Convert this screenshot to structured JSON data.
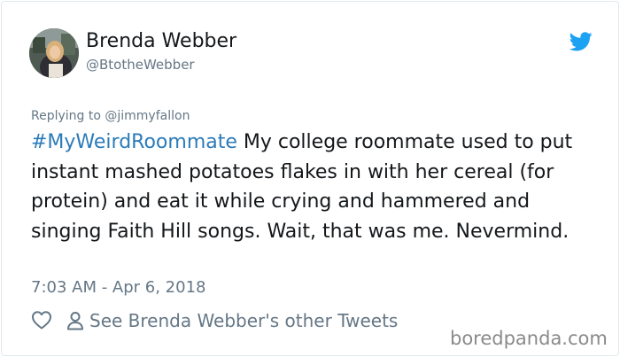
{
  "tweet": {
    "author_name": "Brenda Webber",
    "author_handle": "@BtotheWebber",
    "replying_to": "Replying to @jimmyfallon",
    "hashtag": "#MyWeirdRoommate",
    "body": " My college roommate used to put instant mashed potatoes flakes in with her cereal (for protein) and eat it while crying and hammered and singing Faith Hill songs. Wait, that was me. Nevermind.",
    "timestamp": "7:03 AM - Apr 6, 2018"
  },
  "actions": {
    "like_icon": "heart-icon",
    "profile_icon": "person-icon",
    "other_tweets_label": "See Brenda Webber's other Tweets"
  },
  "watermark": "boredpanda.com",
  "colors": {
    "twitter_blue": "#1da1f2",
    "hashtag": "#2b7bb9",
    "text": "#14171a",
    "muted": "#657786"
  }
}
